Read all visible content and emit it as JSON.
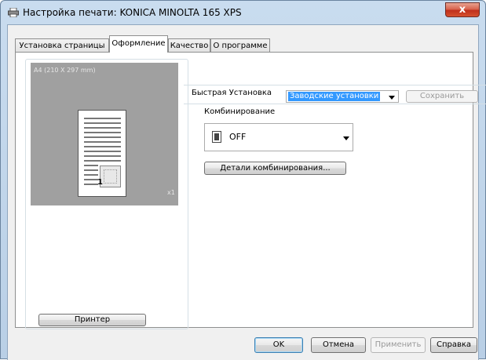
{
  "window": {
    "title": "Настройка печати: KONICA MINOLTA 165 XPS",
    "close_label": "x"
  },
  "tabs": [
    {
      "label": "Установка страницы",
      "active": false
    },
    {
      "label": "Оформление",
      "active": true
    },
    {
      "label": "Качество",
      "active": false
    },
    {
      "label": "О программе",
      "active": false
    }
  ],
  "preview": {
    "paper_size": "A4 (210 X 297 mm)",
    "page_number": "1",
    "copies": "x1"
  },
  "left": {
    "printer_button": "Принтер"
  },
  "quick_setup": {
    "label": "Быстрая Установка",
    "selected": "Заводские установки",
    "save_button": "Сохранить",
    "save_enabled": false
  },
  "combination": {
    "label": "Комбинирование",
    "selected": "OFF",
    "details_button": "Детали комбинирования..."
  },
  "footer": {
    "ok": "OK",
    "cancel": "Отмена",
    "apply": "Применить",
    "apply_enabled": false,
    "help": "Справка"
  }
}
